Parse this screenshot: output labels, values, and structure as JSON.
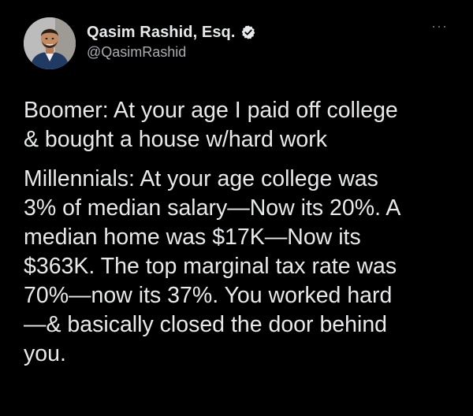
{
  "author": {
    "display_name": "Qasim Rashid, Esq.",
    "handle": "@QasimRashid",
    "verified_icon": "verified-badge-icon",
    "avatar_icon": "avatar-photo"
  },
  "menu": {
    "more_label": "···",
    "more_icon": "more-options-icon"
  },
  "tweet": {
    "paragraphs": [
      {
        "lines": [
          "Boomer: At your age I paid off college",
          "& bought a house w/hard work"
        ]
      },
      {
        "lines": [
          "Millennials: At your age college was",
          "3% of median salary—Now its 20%. A",
          "median home was $17K—Now its",
          "$363K. The top marginal tax rate was",
          "70%—now its 37%. You worked hard",
          "—& basically closed the door behind",
          "you."
        ]
      }
    ]
  },
  "colors": {
    "background": "#000000",
    "text": "#e7e9ea",
    "handle": "#a8adb2",
    "more": "#6e767d"
  }
}
